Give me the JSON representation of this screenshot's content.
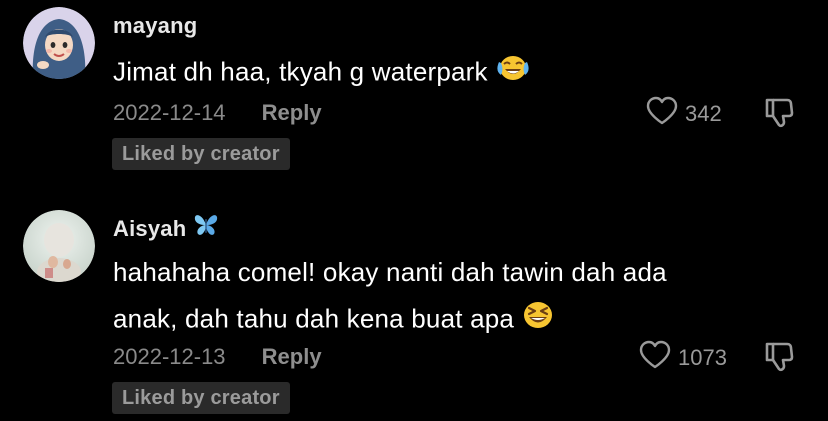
{
  "comments": [
    {
      "username": "mayang",
      "text_line1": "Jimat dh haa, tkyah g waterpark",
      "emoji": "laughing-tears-emoji",
      "date": "2022-12-14",
      "reply_label": "Reply",
      "likes": "342",
      "liked_badge": "Liked by creator"
    },
    {
      "username": "Aisyah",
      "username_icon": "butterfly-icon",
      "text_line1": "hahahaha comel! okay nanti dah tawin dah ada",
      "text_line2": "anak, dah tahu dah kena buat apa",
      "emoji": "grinning-squint-emoji",
      "date": "2022-12-13",
      "reply_label": "Reply",
      "likes": "1073",
      "liked_badge": "Liked by creator"
    }
  ],
  "colors": {
    "background": "#000000",
    "text": "#ffffff",
    "muted": "#8a8a8a",
    "badge_bg": "#2a2a2a",
    "butterfly": "#7ec8f2"
  }
}
